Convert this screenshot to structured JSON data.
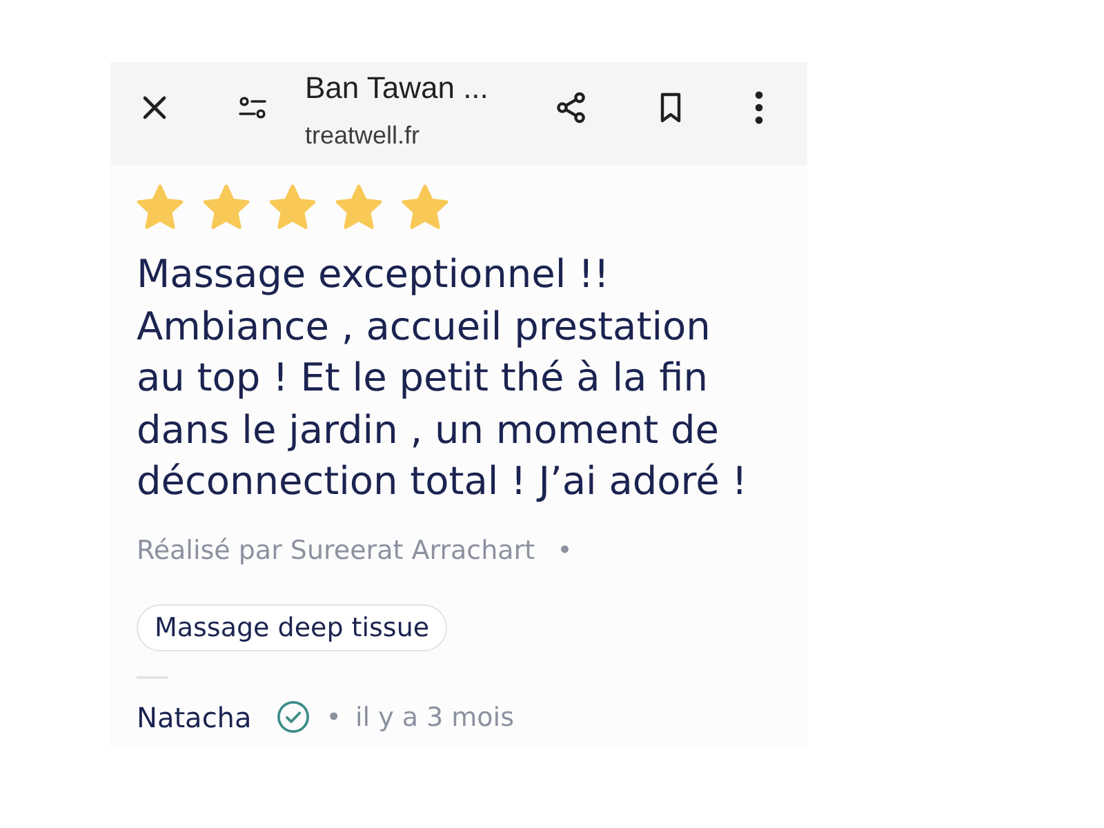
{
  "top_bar": {
    "title": "Ban Tawan ...",
    "subtitle": "treatwell.fr"
  },
  "review": {
    "stars": 5,
    "text": "Massage exceptionnel !! Ambiance , accueil prestation au top ! Et le petit thé à la fin dans le jardin , un moment de déconnection total ! J’ai adoré !",
    "performed_by": "Réalisé par Sureerat Arrachart",
    "performed_by_separator": "•",
    "service_tag": "Massage deep tissue",
    "author": "Natacha",
    "verified": true,
    "date_separator": "•",
    "date": "il y a 3 mois"
  }
}
